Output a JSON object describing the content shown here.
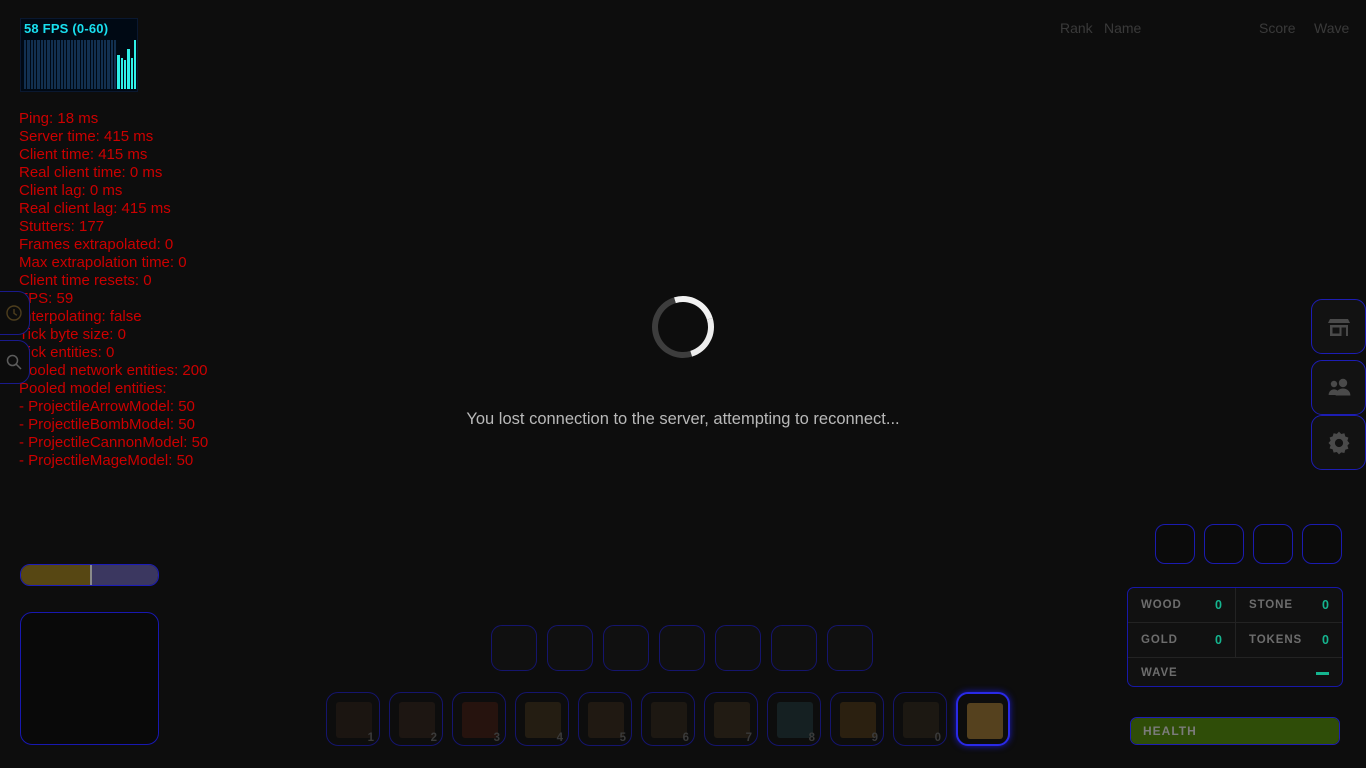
{
  "fps_meter": {
    "label": "58 FPS (0-60)",
    "bar_count": 34,
    "hot_start_index": 28,
    "graph_color": "#2ff0e8",
    "idle_color": "#123050"
  },
  "debug_stats": {
    "lines": [
      "Ping: 18 ms",
      "Server time: 415 ms",
      "Client time: 415 ms",
      "Real client time: 0 ms",
      "Client lag: 0 ms",
      "Real client lag: 415 ms",
      "Stutters: 177",
      "Frames extrapolated: 0",
      "Max extrapolation time: 0",
      "Client time resets: 0",
      "FPS: 59",
      "Interpolating: false",
      "Tick byte size: 0",
      "Tick entities: 0",
      "Pooled network entities: 200",
      "Pooled model entities:",
      "- ProjectileArrowModel: 50",
      "- ProjectileBombModel: 50",
      "- ProjectileCannonModel: 50",
      "- ProjectileMageModel: 50"
    ],
    "color": "#cc0000"
  },
  "edge_buttons": [
    {
      "name": "timer-button",
      "icon": "clock-icon"
    },
    {
      "name": "zoom-button",
      "icon": "magnifier-icon"
    }
  ],
  "leaderboard": {
    "rank": "Rank",
    "name": "Name",
    "score": "Score",
    "wave": "Wave"
  },
  "disconnect": {
    "message": "You lost connection to the server, attempting to reconnect...",
    "spinner": "loading-spinner"
  },
  "side_menu": [
    {
      "name": "shop-button",
      "icon": "shop-icon"
    },
    {
      "name": "friends-button",
      "icon": "people-icon"
    },
    {
      "name": "settings-button",
      "icon": "gear-icon"
    }
  ],
  "equip_slots": [
    {
      "index": 1,
      "empty": true
    },
    {
      "index": 2,
      "empty": true
    },
    {
      "index": 3,
      "empty": true
    },
    {
      "index": 4,
      "empty": true
    }
  ],
  "resources": {
    "wood_label": "WOOD",
    "wood_value": "0",
    "stone_label": "STONE",
    "stone_value": "0",
    "gold_label": "GOLD",
    "gold_value": "0",
    "tokens_label": "TOKENS",
    "tokens_value": "0",
    "wave_label": "WAVE",
    "wave_value": "",
    "accent_color": "#15b58f"
  },
  "health": {
    "label": "HEALTH",
    "percent": 100,
    "fill_color": "#2f4d08"
  },
  "xp_bar": {
    "percent": 50,
    "left_color": "#574713",
    "right_color": "#3b3760"
  },
  "minimap": {
    "name": "minimap-panel"
  },
  "upper_slots": [
    {
      "index": 1
    },
    {
      "index": 2
    },
    {
      "index": 3
    },
    {
      "index": 4
    },
    {
      "index": 5
    },
    {
      "index": 6
    },
    {
      "index": 7
    }
  ],
  "hotbar": [
    {
      "key": "1",
      "item": "wall-block",
      "color": "#2a1d16",
      "selected": false
    },
    {
      "key": "2",
      "item": "door-block",
      "color": "#2e2018",
      "selected": false
    },
    {
      "key": "3",
      "item": "spike-trap",
      "color": "#401a10",
      "selected": false
    },
    {
      "key": "4",
      "item": "ballista-tower",
      "color": "#3b2d18",
      "selected": false
    },
    {
      "key": "5",
      "item": "cannon-tower",
      "color": "#342617",
      "selected": false
    },
    {
      "key": "6",
      "item": "arrow-tower",
      "color": "#2e2418",
      "selected": false
    },
    {
      "key": "7",
      "item": "gear-tower",
      "color": "#352a1a",
      "selected": false
    },
    {
      "key": "8",
      "item": "mage-tower",
      "color": "#1d3338",
      "selected": false
    },
    {
      "key": "9",
      "item": "gold-mine",
      "color": "#4a3413",
      "selected": false
    },
    {
      "key": "0",
      "item": "harvester",
      "color": "#2b2418",
      "selected": false
    },
    {
      "key": "",
      "item": "stone-block",
      "color": "#5a4420",
      "selected": true
    }
  ]
}
